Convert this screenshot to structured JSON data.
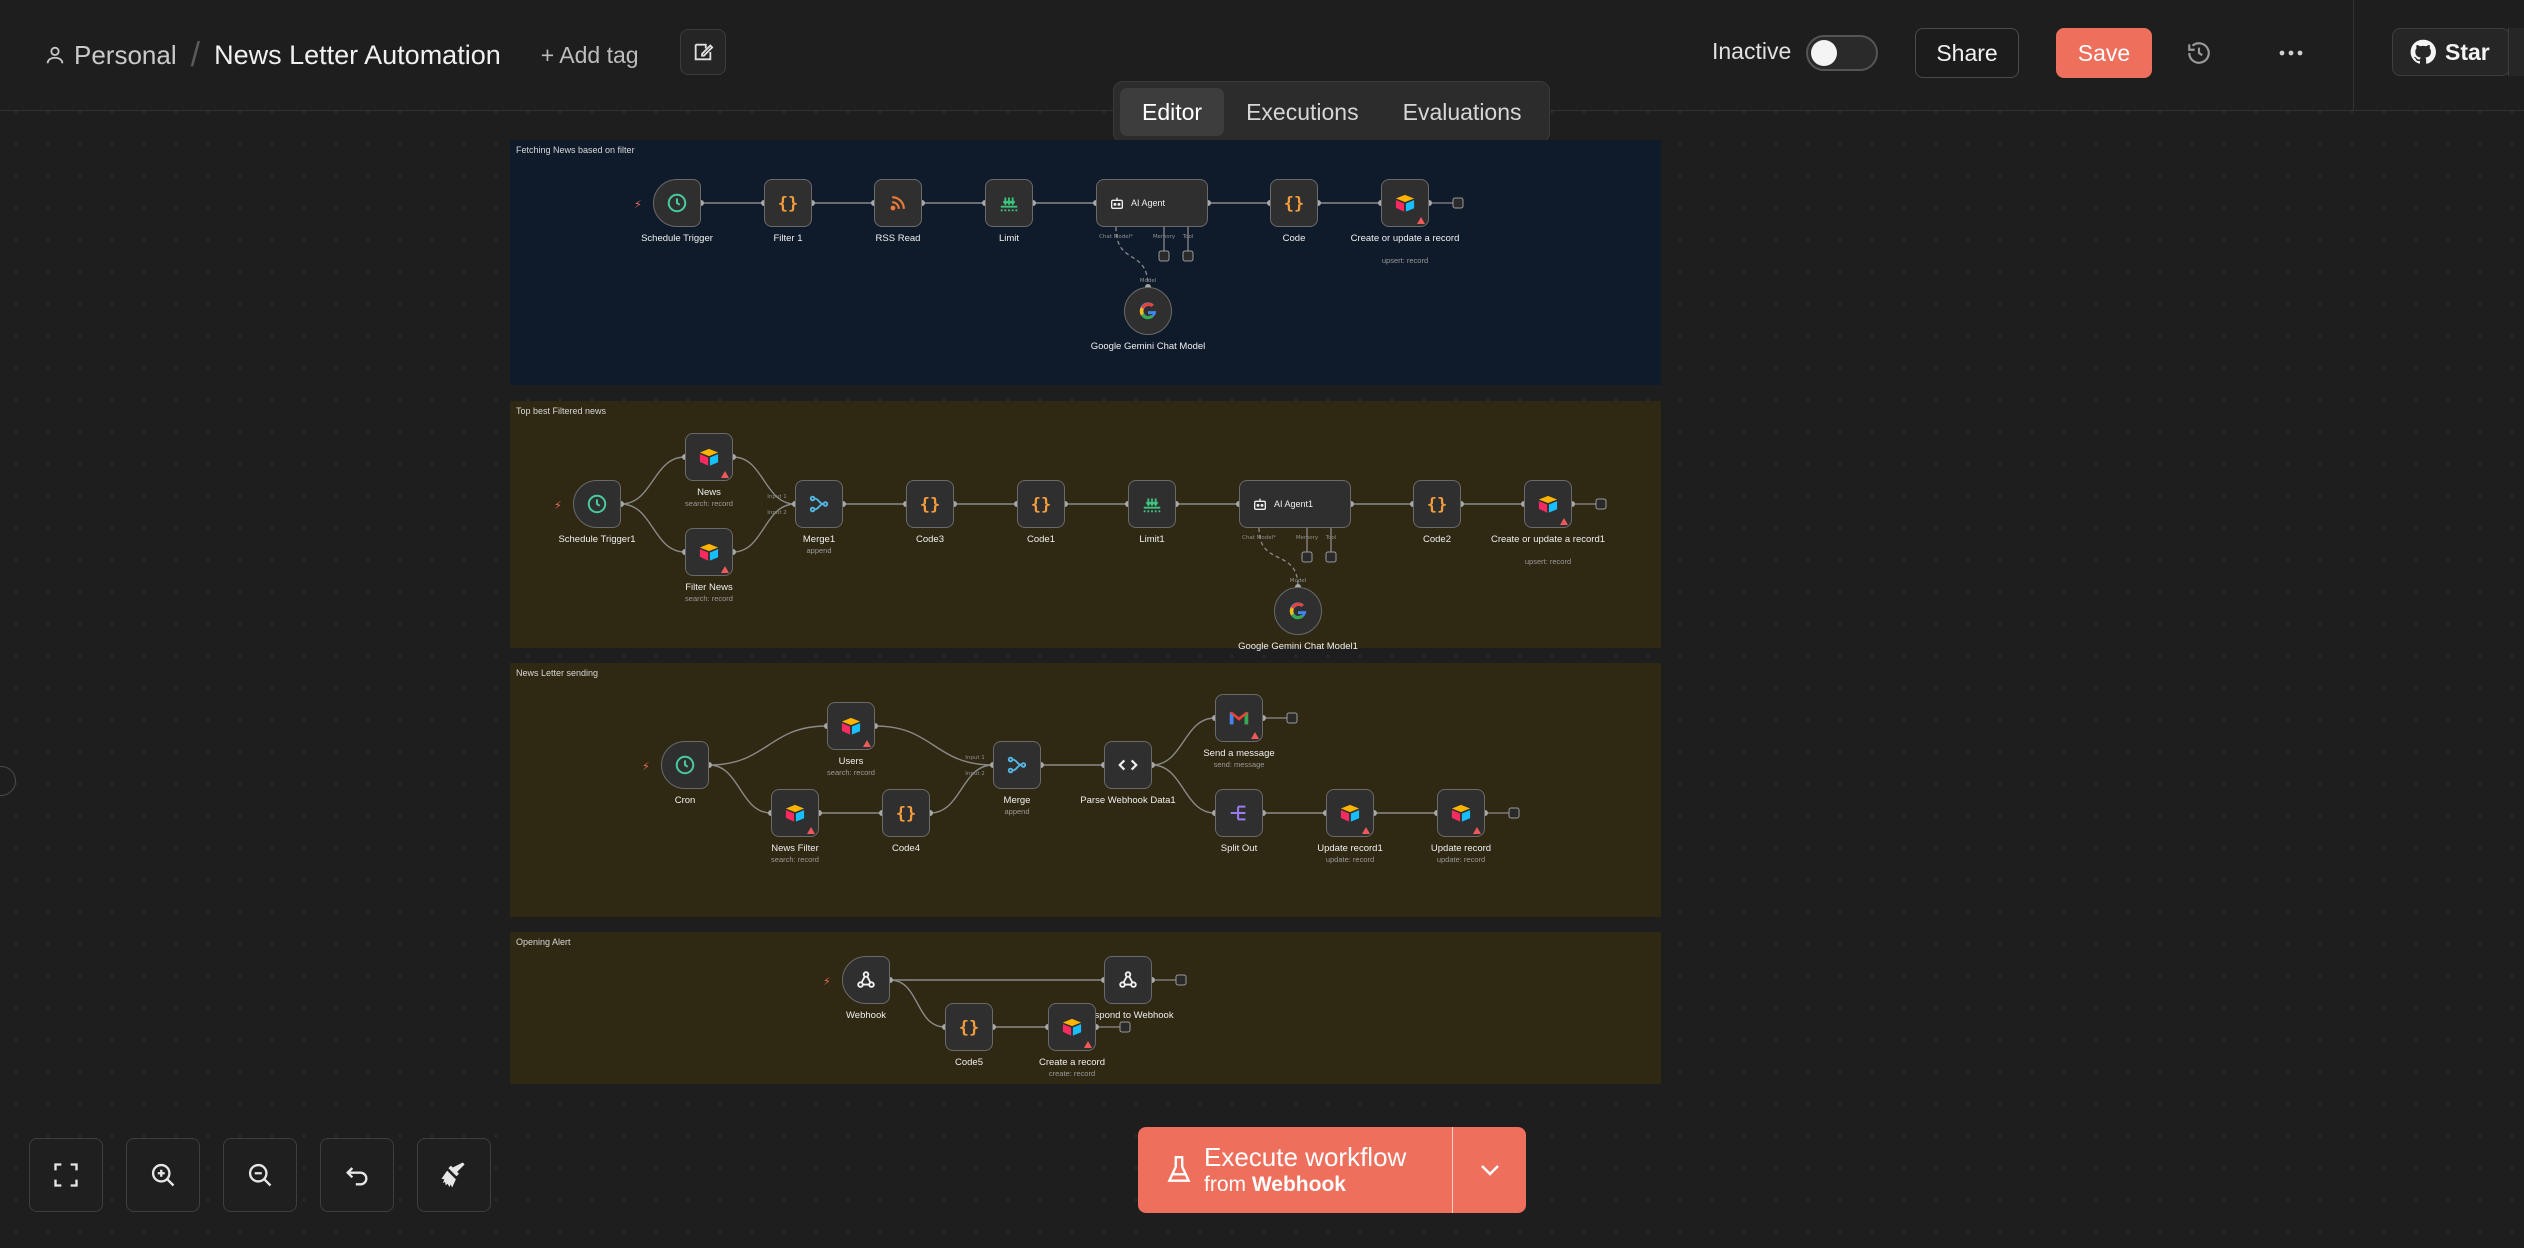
{
  "header": {
    "project": "Personal",
    "workflow_name": "News Letter Automation",
    "add_tag": "+ Add tag",
    "status_label": "Inactive",
    "share": "Share",
    "save": "Save",
    "star": "Star"
  },
  "tabs": [
    {
      "label": "Editor",
      "active": true
    },
    {
      "label": "Executions",
      "active": false
    },
    {
      "label": "Evaluations",
      "active": false
    }
  ],
  "execute": {
    "title": "Execute workflow",
    "from_prefix": "from",
    "from_node": "Webhook"
  },
  "colors": {
    "accent": "#ed6f5c",
    "sticky_blue": "#0f1b2b",
    "sticky_yellow": "#2f2812"
  },
  "stickies": [
    {
      "label": "Fetching News based on filter",
      "color": "blue"
    },
    {
      "label": "Top best Filtered news",
      "color": "yellow"
    },
    {
      "label": "News Letter sending",
      "color": "yellow"
    },
    {
      "label": "Opening Alert",
      "color": "yellow"
    }
  ],
  "nodes": [
    {
      "id": "n1",
      "label": "Schedule Trigger",
      "sub": "",
      "icon": "clock-icon",
      "kind": "trigger"
    },
    {
      "id": "n2",
      "label": "Filter 1",
      "sub": "",
      "icon": "code-braces-icon"
    },
    {
      "id": "n3",
      "label": "RSS Read",
      "sub": "",
      "icon": "rss-icon"
    },
    {
      "id": "n4",
      "label": "Limit",
      "sub": "",
      "icon": "limit-icon"
    },
    {
      "id": "n5",
      "label": "AI Agent",
      "sub": "",
      "icon": "robot-icon",
      "kind": "agent"
    },
    {
      "id": "n6",
      "label": "Code",
      "sub": "",
      "icon": "code-braces-icon"
    },
    {
      "id": "n7",
      "label": "Create or update a record",
      "sub": "upsert: record",
      "icon": "airtable-icon",
      "warn": true
    },
    {
      "id": "n8",
      "label": "Google Gemini Chat Model",
      "sub": "",
      "icon": "gemini-icon",
      "kind": "round"
    },
    {
      "id": "m1",
      "label": "Schedule Trigger1",
      "sub": "",
      "icon": "clock-icon",
      "kind": "trigger"
    },
    {
      "id": "m2",
      "label": "News",
      "sub": "search: record",
      "icon": "airtable-icon",
      "warn": true
    },
    {
      "id": "m3",
      "label": "Filter News",
      "sub": "search: record",
      "icon": "airtable-icon",
      "warn": true
    },
    {
      "id": "m4",
      "label": "Merge1",
      "sub": "append",
      "icon": "merge-icon"
    },
    {
      "id": "m5",
      "label": "Code3",
      "sub": "",
      "icon": "code-braces-icon"
    },
    {
      "id": "m6",
      "label": "Code1",
      "sub": "",
      "icon": "code-braces-icon"
    },
    {
      "id": "m7",
      "label": "Limit1",
      "sub": "",
      "icon": "limit-icon"
    },
    {
      "id": "m8",
      "label": "AI Agent1",
      "sub": "",
      "icon": "robot-icon",
      "kind": "agent"
    },
    {
      "id": "m9",
      "label": "Code2",
      "sub": "",
      "icon": "code-braces-icon"
    },
    {
      "id": "m10",
      "label": "Create or update a record1",
      "sub": "upsert: record",
      "icon": "airtable-icon",
      "warn": true
    },
    {
      "id": "m11",
      "label": "Google Gemini Chat Model1",
      "sub": "",
      "icon": "gemini-icon",
      "kind": "round"
    },
    {
      "id": "s1",
      "label": "Cron",
      "sub": "",
      "icon": "clock-icon",
      "kind": "trigger"
    },
    {
      "id": "s2",
      "label": "Users",
      "sub": "search: record",
      "icon": "airtable-icon",
      "warn": true
    },
    {
      "id": "s3",
      "label": "News Filter",
      "sub": "search: record",
      "icon": "airtable-icon",
      "warn": true
    },
    {
      "id": "s4",
      "label": "Code4",
      "sub": "",
      "icon": "code-braces-icon"
    },
    {
      "id": "s5",
      "label": "Merge",
      "sub": "append",
      "icon": "merge-icon"
    },
    {
      "id": "s6",
      "label": "Parse Webhook Data1",
      "sub": "",
      "icon": "html-icon"
    },
    {
      "id": "s7",
      "label": "Send a message",
      "sub": "send: message",
      "icon": "gmail-icon",
      "warn": true
    },
    {
      "id": "s8",
      "label": "Split Out",
      "sub": "",
      "icon": "split-icon"
    },
    {
      "id": "s9",
      "label": "Update record1",
      "sub": "update: record",
      "icon": "airtable-icon",
      "warn": true
    },
    {
      "id": "s10",
      "label": "Update record",
      "sub": "update: record",
      "icon": "airtable-icon",
      "warn": true
    },
    {
      "id": "w1",
      "label": "Webhook",
      "sub": "",
      "icon": "webhook-icon",
      "kind": "trigger"
    },
    {
      "id": "w2",
      "label": "Respond to Webhook",
      "sub": "",
      "icon": "webhook-icon"
    },
    {
      "id": "w3",
      "label": "Code5",
      "sub": "",
      "icon": "code-braces-icon"
    },
    {
      "id": "w4",
      "label": "Create a record",
      "sub": "create: record",
      "icon": "airtable-icon",
      "warn": true
    }
  ],
  "port_labels": {
    "agent_chat_model": "Chat Model*",
    "agent_memory": "Memory",
    "agent_tool": "Tool",
    "model_port": "Model",
    "merge_in1": "Input 1",
    "merge_in2": "Input 2"
  }
}
